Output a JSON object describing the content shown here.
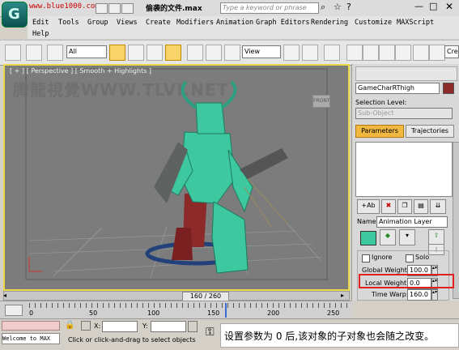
{
  "title_bar": {
    "site_watermark": "www.blue1000.com",
    "filename": "偷袭的文件.max",
    "search_placeholder": "Type a keyword or phrase"
  },
  "menus": [
    "Edit",
    "Tools",
    "Group",
    "Views",
    "Create",
    "Modifiers",
    "Animation",
    "Graph Editors",
    "Rendering",
    "Customize",
    "MAXScript",
    "Help"
  ],
  "toolbar": {
    "selection_filter": "All",
    "ref_coord": "View",
    "right_field": "Cre"
  },
  "viewport": {
    "label": "[ + ] [ Perspective ] [ Smooth + Highlights ]",
    "watermark": "腾龍視覺WWW.TLVI.NET",
    "viewcube_label": "FRONT"
  },
  "command_panel": {
    "object_name": "GameCharRThigh",
    "object_color": "#8c2a2a",
    "selection_level_label": "Selection Level:",
    "sub_object_placeholder": "Sub-Object",
    "tabs": [
      "Parameters",
      "Trajectories"
    ],
    "name_label": "Name:",
    "layer_name": "Animation Layer",
    "layer_color": "#3ec8a0",
    "ignore_label": "Ignore",
    "solo_label": "Solo",
    "global_weight_label": "Global Weight:",
    "global_weight": "100.0",
    "local_weight_label": "Local Weight:",
    "local_weight": "0.0",
    "time_warp_label": "Time Warp:",
    "time_warp": "160.0"
  },
  "timeline": {
    "frame_slider": "160 / 260",
    "current_frame_fraction": 0.615,
    "ticks": [
      "0",
      "50",
      "100",
      "150",
      "200",
      "250"
    ]
  },
  "status": {
    "welcome": "Welcome to MAX",
    "x_label": "X:",
    "y_label": "Y:",
    "prompt": "Click or click-and-drag to select objects"
  },
  "caption": "设置参数为 0 后,该对象的子对象也会随之改变。",
  "colors": {
    "highlight_frame": "#e8d84a",
    "annotation_box": "#e02020",
    "character": "#3ec8a0"
  }
}
